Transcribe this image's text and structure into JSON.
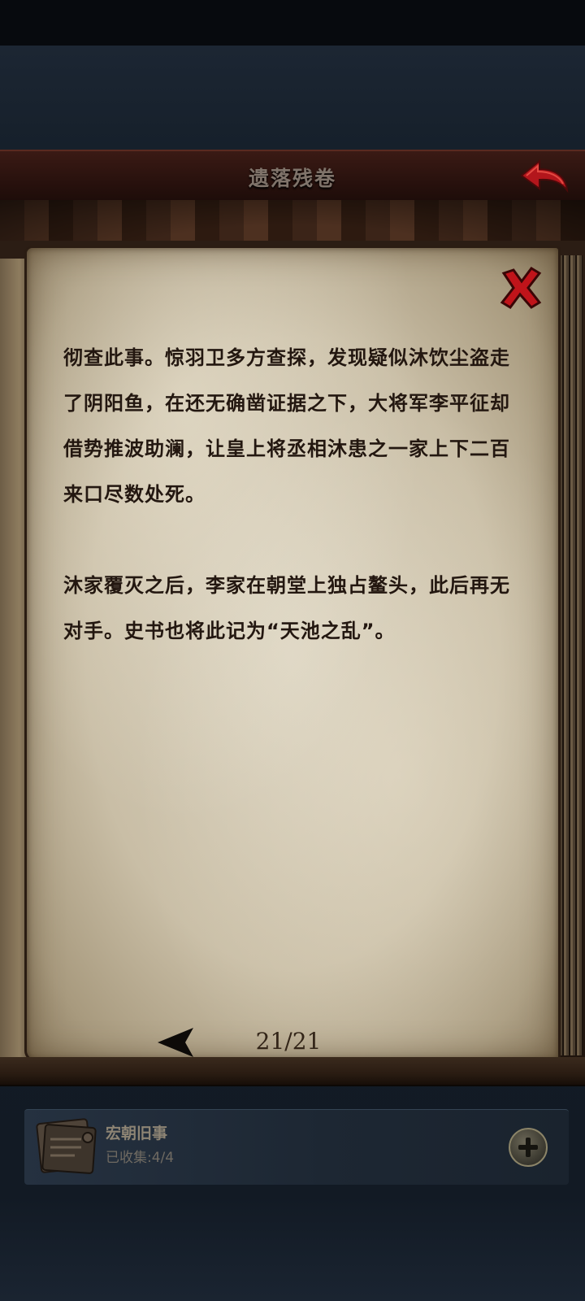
{
  "header": {
    "title": "遗落残卷"
  },
  "document": {
    "paragraphs": [
      "彻查此事。惊羽卫多方查探，发现疑似沐饮尘盗走了阴阳鱼，在还无确凿证据之下，大将军李平征却借势推波助澜，让皇上将丞相沐患之一家上下二百来口尽数处死。",
      "沐家覆灭之后，李家在朝堂上独占鳌头，此后再无对手。史书也将此记为“天池之乱”。"
    ],
    "page_indicator": "21/21"
  },
  "collection": {
    "name": "宏朝旧事",
    "progress": "已收集:4/4"
  },
  "colors": {
    "title_bar": "#2a120e",
    "parchment": "#c9bea6",
    "close_red": "#c0141a",
    "back_red": "#b3161c",
    "body_text": "#231710"
  },
  "icons": {
    "back": "curved-back-arrow-icon",
    "close": "x-close-icon",
    "prev": "triangle-left-icon",
    "collection": "book-stack-icon",
    "add": "plus-circle-icon"
  }
}
